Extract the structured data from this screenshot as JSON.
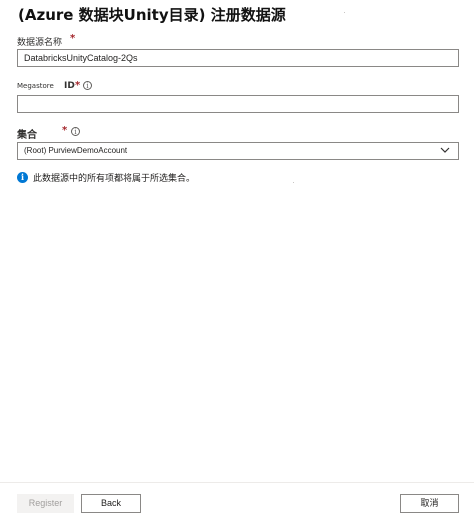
{
  "header": {
    "title": "(Azure 数据块Unity目录) 注册数据源"
  },
  "form": {
    "name_field": {
      "label": "数据源名称",
      "required_mark": "*",
      "value": "DatabricksUnityCatalog-2Qs"
    },
    "megastore_field": {
      "label_prefix": "Megastore",
      "label_suffix": "ID",
      "required_mark": "*",
      "info_glyph": "i",
      "value": ""
    },
    "collection_field": {
      "label": "集合",
      "required_mark": "*",
      "info_glyph": "i",
      "selected_value": "(Root) PurviewDemoAccount"
    },
    "info_message": {
      "icon": "info-icon",
      "glyph": "i",
      "text": "此数据源中的所有项都将属于所选集合。"
    }
  },
  "footer": {
    "register_label": "Register",
    "back_label": "Back",
    "cancel_label": "取消"
  },
  "colors": {
    "accent": "#0078d4",
    "required": "#a4262c",
    "border": "#8a8886"
  }
}
